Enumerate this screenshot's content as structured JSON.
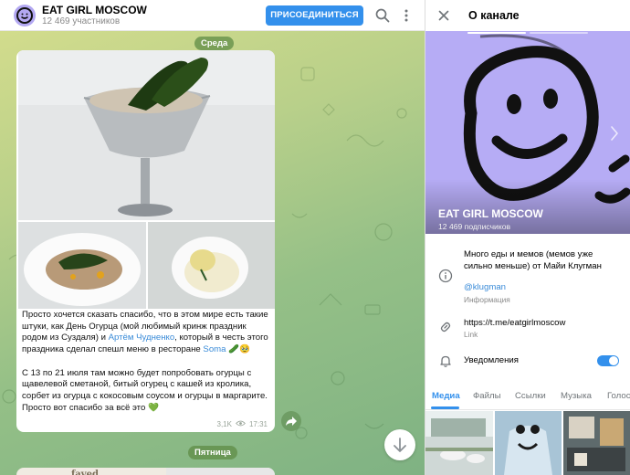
{
  "channel": {
    "title": "EAT GIRL MOSCOW",
    "participants": "12 469 участников",
    "join_label": "ПРИСОЕДИНИТЬСЯ"
  },
  "chat": {
    "date_pill_1": "Среда",
    "date_pill_2": "Пятница",
    "message": {
      "p1_part1": "Просто хочется сказать спасибо, что в этом мире есть такие штуки, как День Огурца (мой любимый кринж праздник родом из Суздаля) и ",
      "p1_link1": "Артём Чудненко",
      "p1_part2": ", который в честь этого праздника сделал спешл меню в ресторане ",
      "p1_link2": "Soma",
      "p1_emoji": " 🥒🥹",
      "p2": "С 13 по 21 июля там можно будет попробовать огурцы с щавелевой сметаной, битый огурец с кашей из кролика, сорбет из огурца с кокосовым соусом и огурцы в маргарите. Просто вот спасибо за всё это 💚",
      "views": "3,1K",
      "time": "17:31"
    },
    "next_preview_text": "faved"
  },
  "panel": {
    "title": "О канале",
    "cover_name": "EAT GIRL MOSCOW",
    "cover_subscribers": "12 469 подписчиков",
    "description": "Много еды и мемов (мемов уже сильно меньше) от Майи Клугман",
    "username": "@klugman",
    "info_label": "Информация",
    "link": "https://t.me/eatgirlmoscow",
    "link_label": "Link",
    "notifications_label": "Уведомления",
    "notifications_on": true,
    "tabs": [
      "Медиа",
      "Файлы",
      "Ссылки",
      "Музыка",
      "Голос"
    ]
  },
  "colors": {
    "accent": "#3390ec",
    "link": "#3a8bd8",
    "avatar_bg": "#b6acf5",
    "chat_bg_top": "#d2dc8c",
    "chat_bg_bottom": "#7fb283"
  },
  "icons": [
    "search-icon",
    "more-vertical-icon",
    "close-icon",
    "info-icon",
    "link-icon",
    "bell-icon",
    "share-icon",
    "arrow-down-icon",
    "eye-icon",
    "chevron-right-icon"
  ]
}
